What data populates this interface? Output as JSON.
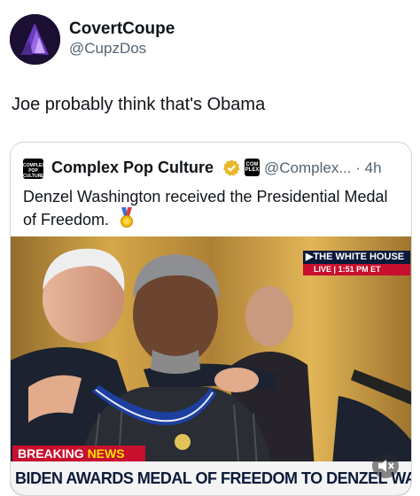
{
  "author": {
    "name": "CovertCoupe",
    "handle": "@CupzDos"
  },
  "tweet": {
    "text": "Joe probably think that's Obama"
  },
  "quote": {
    "logo_text": "COMPLEX POP CULTURE",
    "name": "Complex Pop Culture",
    "affiliate_badge_text": "COM PLEX",
    "handle": "@Complex...",
    "separator": "·",
    "time": "4h",
    "text": "Denzel Washington received the Presidential Medal of Freedom."
  },
  "media": {
    "broadcaster_label": "▶THE WHITE HOUSE",
    "live_label": "LIVE",
    "live_time": "1:51 PM ET",
    "breaking_label": "BREAKING",
    "breaking_news": "NEWS",
    "headline": "BIDEN AWARDS MEDAL OF FREEDOM TO DENZEL WASHINGTON"
  },
  "icons": {
    "verified": "verified-gold-badge-icon",
    "medal": "sports-medal-icon",
    "mute": "mute-speaker-icon"
  },
  "colors": {
    "verified_gold": "#e8b829",
    "breaking_red": "#c8102e",
    "news_yellow": "#ffe100",
    "text_secondary": "#536471"
  }
}
